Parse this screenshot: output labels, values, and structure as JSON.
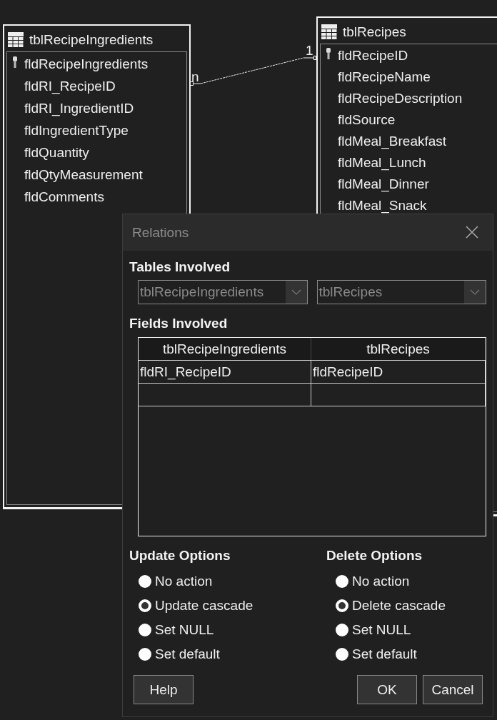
{
  "tables": [
    {
      "title": "tblRecipeIngredients",
      "fields": [
        {
          "name": "fldRecipeIngredients",
          "primary_key": true
        },
        {
          "name": "fldRI_RecipeID",
          "primary_key": false
        },
        {
          "name": "fldRI_IngredientID",
          "primary_key": false
        },
        {
          "name": "fldIngredientType",
          "primary_key": false
        },
        {
          "name": "fldQuantity",
          "primary_key": false
        },
        {
          "name": "fldQtyMeasurement",
          "primary_key": false
        },
        {
          "name": "fldComments",
          "primary_key": false
        }
      ]
    },
    {
      "title": "tblRecipes",
      "fields": [
        {
          "name": "fldRecipeID",
          "primary_key": true
        },
        {
          "name": "fldRecipeName",
          "primary_key": false
        },
        {
          "name": "fldRecipeDescription",
          "primary_key": false
        },
        {
          "name": "fldSource",
          "primary_key": false
        },
        {
          "name": "fldMeal_Breakfast",
          "primary_key": false
        },
        {
          "name": "fldMeal_Lunch",
          "primary_key": false
        },
        {
          "name": "fldMeal_Dinner",
          "primary_key": false
        },
        {
          "name": "fldMeal_Snack",
          "primary_key": false
        }
      ]
    }
  ],
  "relation": {
    "from_label": "n",
    "to_label": "1"
  },
  "dialog": {
    "title": "Relations",
    "tables_heading": "Tables Involved",
    "table_selects": [
      {
        "value": "tblRecipeIngredients",
        "disabled": true
      },
      {
        "value": "tblRecipes",
        "disabled": true
      }
    ],
    "fields_heading": "Fields Involved",
    "grid": {
      "columns": [
        "tblRecipeIngredients",
        "tblRecipes"
      ],
      "rows": [
        [
          "fldRI_RecipeID",
          "fldRecipeID"
        ]
      ]
    },
    "option_groups": [
      {
        "heading": "Update Options",
        "options": [
          {
            "label": "No action",
            "selected": false
          },
          {
            "label": "Update cascade",
            "selected": true
          },
          {
            "label": "Set NULL",
            "selected": false
          },
          {
            "label": "Set default",
            "selected": false
          }
        ]
      },
      {
        "heading": "Delete Options",
        "options": [
          {
            "label": "No action",
            "selected": false
          },
          {
            "label": "Delete cascade",
            "selected": true
          },
          {
            "label": "Set NULL",
            "selected": false
          },
          {
            "label": "Set default",
            "selected": false
          }
        ]
      }
    ],
    "buttons": [
      {
        "label": "Help"
      },
      {
        "label": "OK"
      },
      {
        "label": "Cancel"
      }
    ]
  }
}
